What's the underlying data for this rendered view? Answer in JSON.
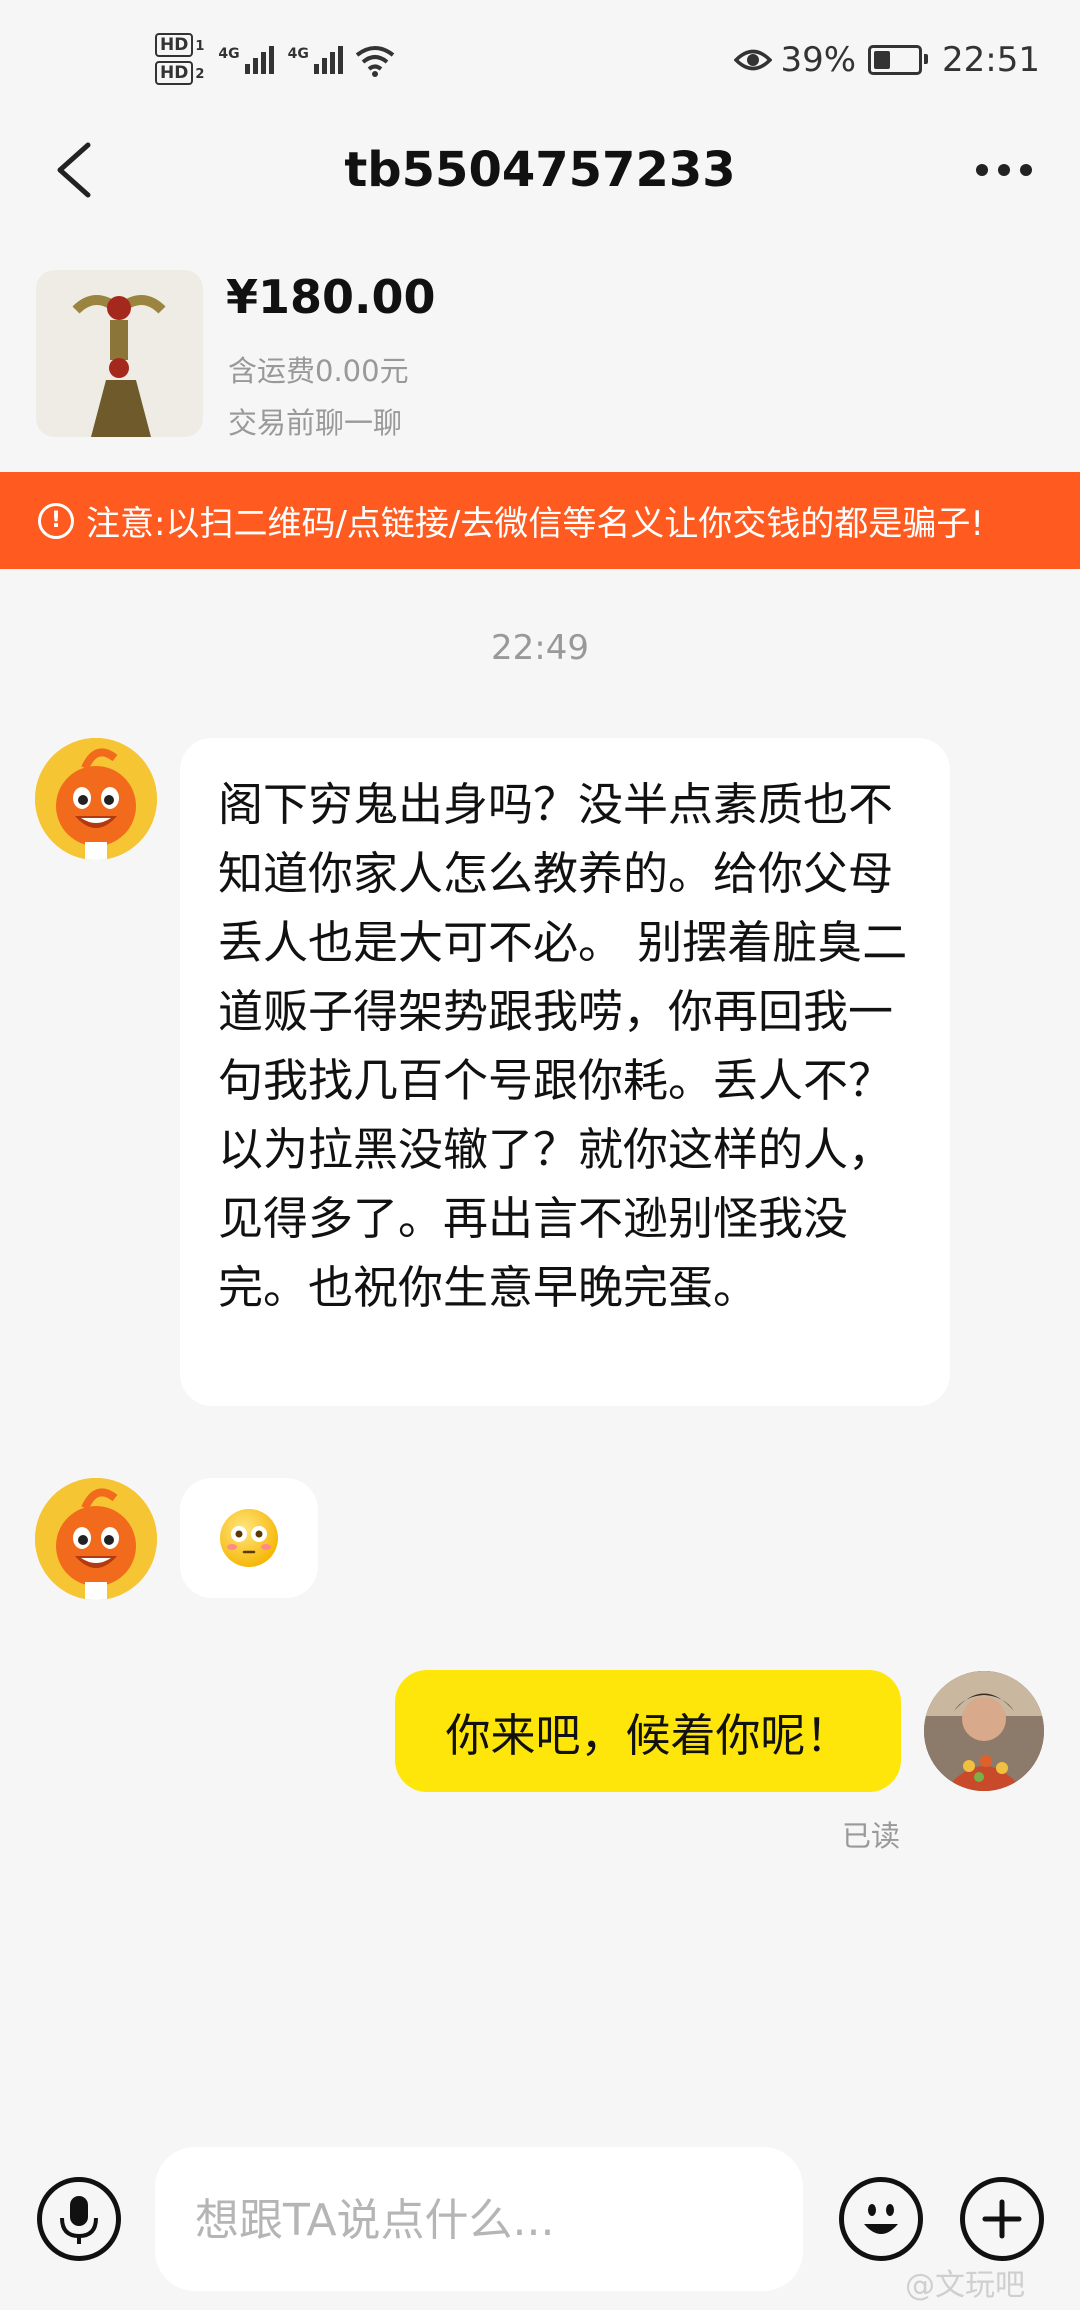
{
  "status_bar": {
    "hd1": "HD",
    "hd1_sub": "1",
    "hd2": "HD",
    "hd2_sub": "2",
    "net1": "4G",
    "net2": "4G",
    "battery_percent": "39%",
    "battery_level": 0.39,
    "time": "22:51"
  },
  "header": {
    "title": "tb5504757233",
    "back_icon": "chevron-left-icon",
    "more_icon": "more-dots-icon"
  },
  "product": {
    "price": "¥180.00",
    "shipping": "含运费0.00元",
    "chat_hint": "交易前聊一聊"
  },
  "warning": {
    "icon": "!",
    "text": "注意:以扫二维码/点链接/去微信等名义让你交钱的都是骗子!"
  },
  "chat": {
    "timestamp": "22:49",
    "messages": [
      {
        "sender": "them",
        "text": "阁下穷鬼出身吗？没半点素质也不知道你家人怎么教养的。给你父母丢人也是大可不必。 别摆着脏臭二道贩子得架势跟我唠，你再回我一句我找几百个号跟你耗。丢人不？以为拉黑没辙了？就你这样的人，见得多了。再出言不逊别怪我没完。也祝你生意早晚完蛋。"
      },
      {
        "sender": "them",
        "emoji": "flushed-face-emoji"
      },
      {
        "sender": "me",
        "text": "你来吧，候着你呢！",
        "status": "已读"
      }
    ]
  },
  "input_bar": {
    "placeholder": "想跟TA说点什么...",
    "value": ""
  },
  "watermark": "@文玩吧",
  "colors": {
    "warning_bg": "#ff5a1f",
    "my_bubble": "#ffe60a",
    "background": "#f6f6f6"
  }
}
